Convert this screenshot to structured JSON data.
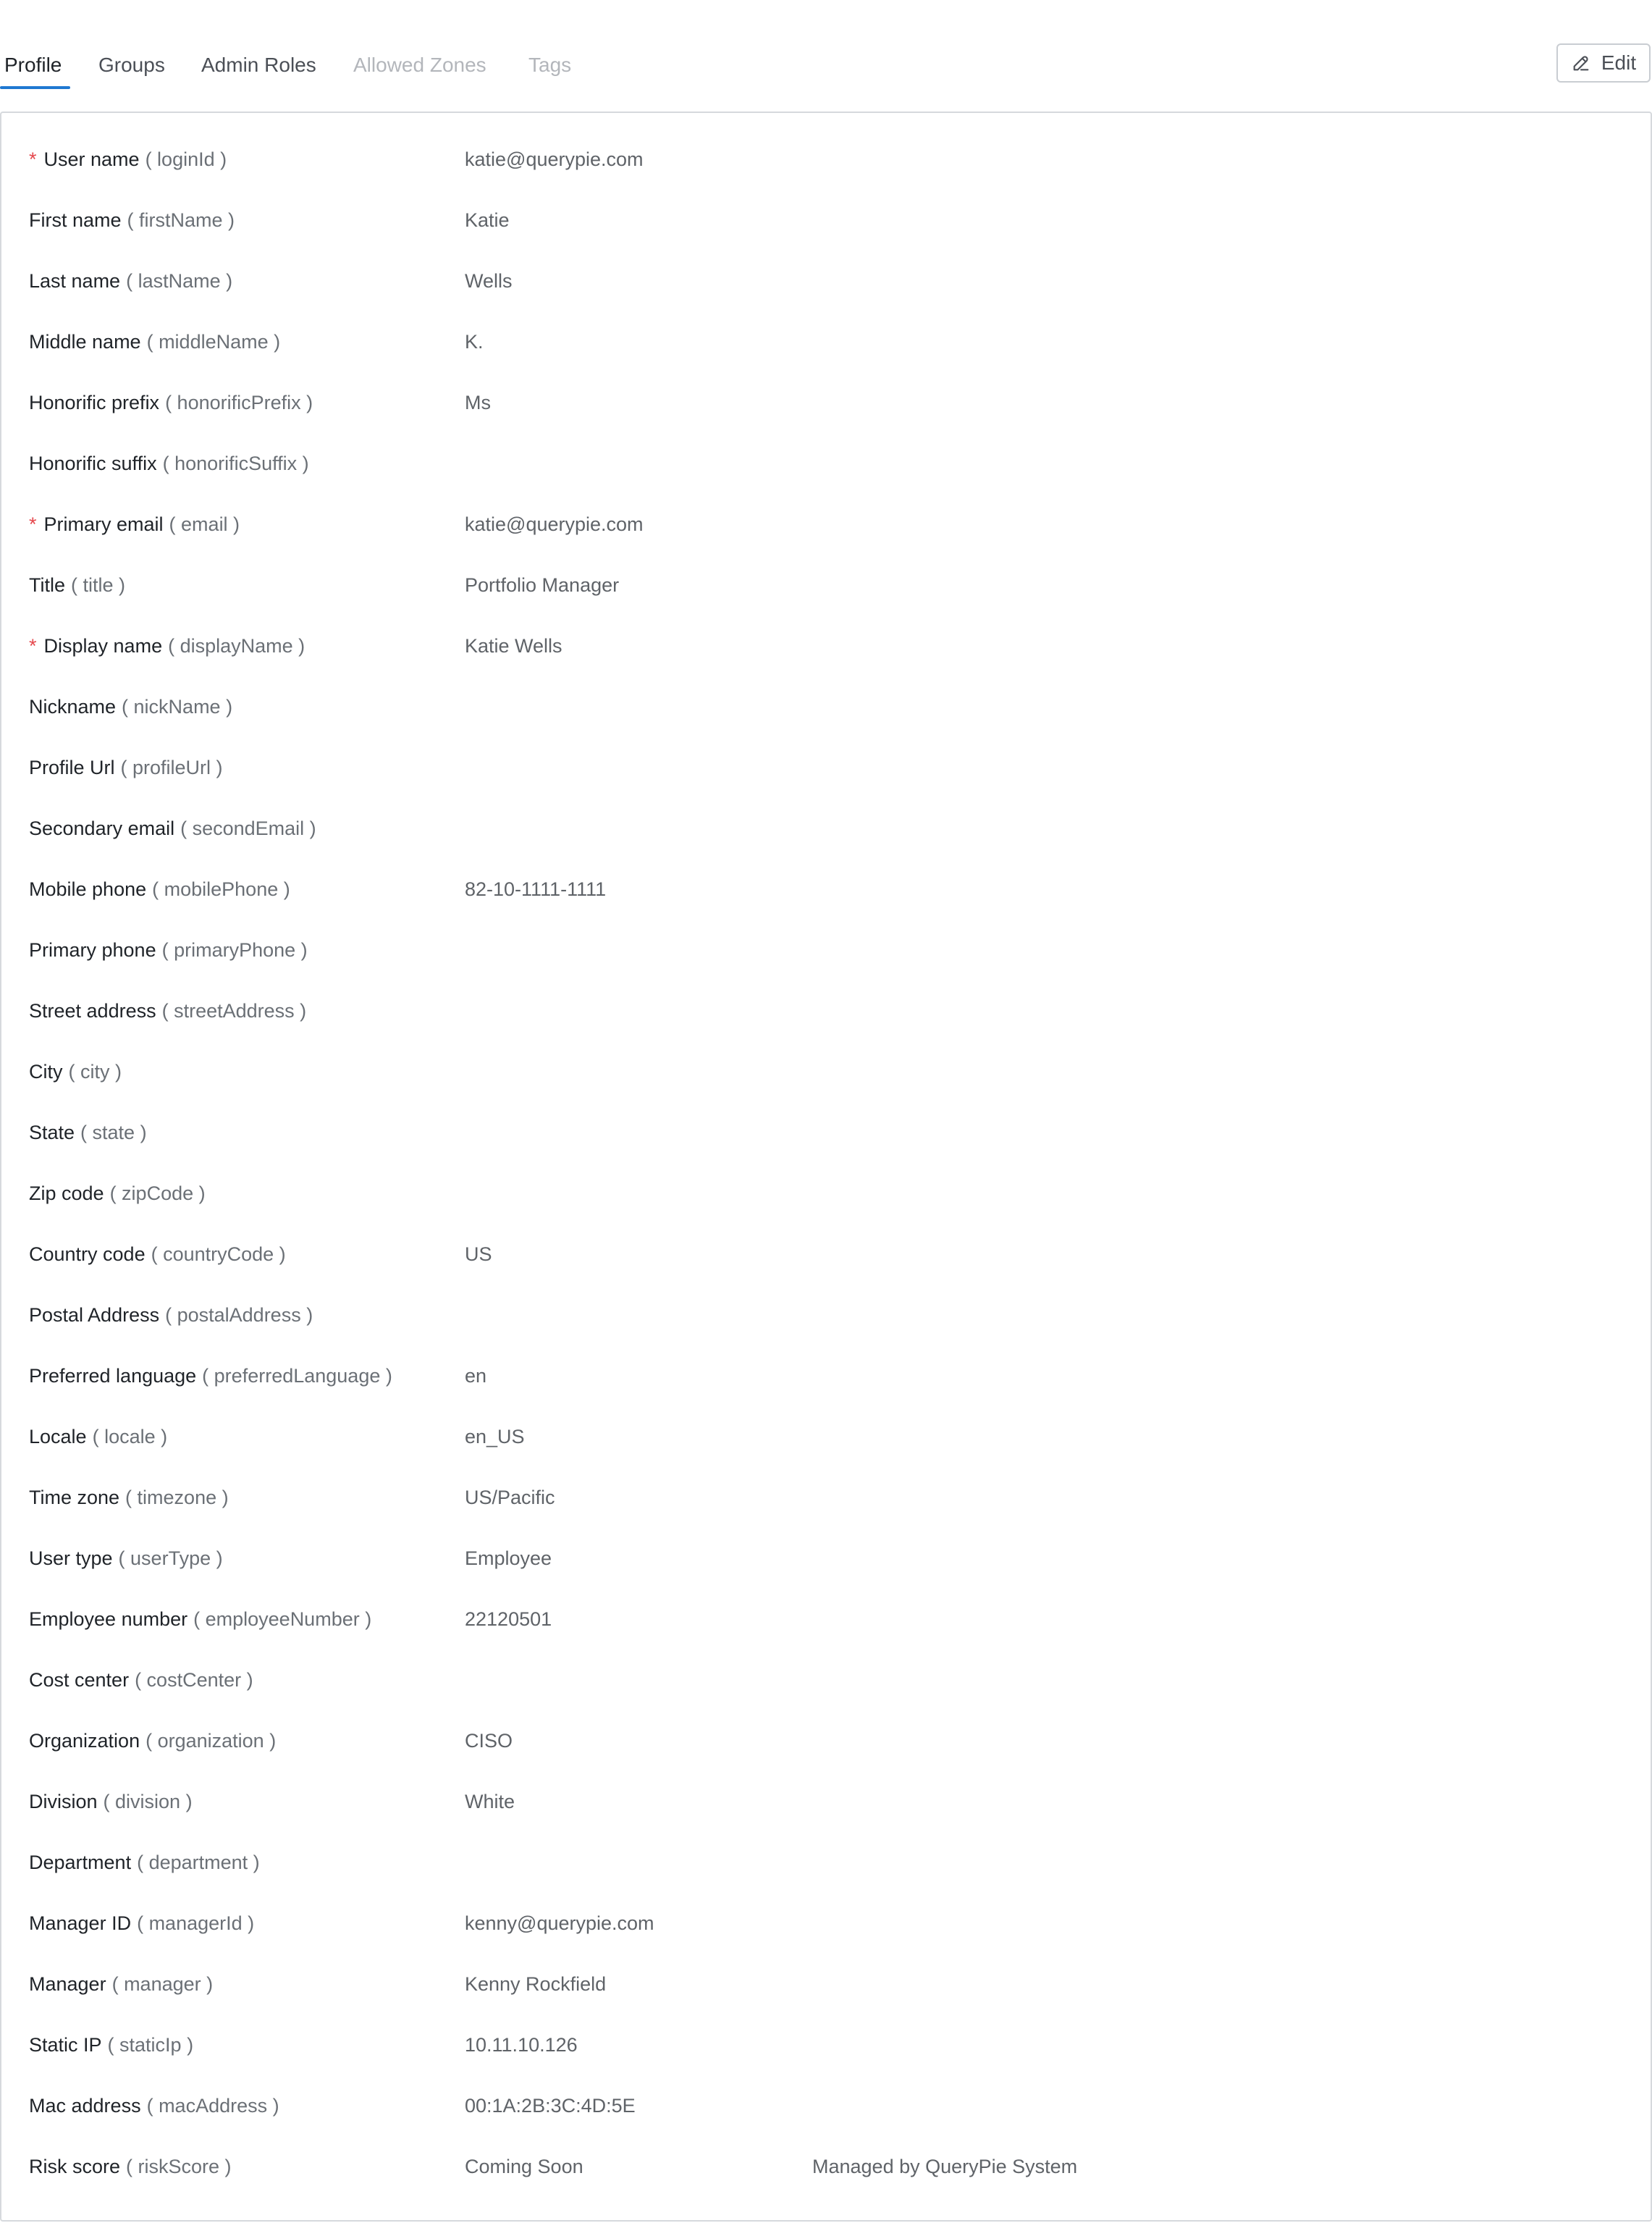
{
  "tabs": [
    {
      "label": "Profile",
      "state": "active"
    },
    {
      "label": "Groups",
      "state": "enabled"
    },
    {
      "label": "Admin Roles",
      "state": "enabled"
    },
    {
      "label": "Allowed Zones",
      "state": "disabled"
    },
    {
      "label": "Tags",
      "state": "disabled"
    }
  ],
  "edit_button": {
    "label": "Edit",
    "icon": "pencil-icon"
  },
  "colors": {
    "accent": "#1f78d1",
    "required": "#e5484d",
    "disabled_tab": "#b3b6bb"
  },
  "fields": [
    {
      "required": true,
      "name": "User name",
      "key": "( loginId )",
      "value": "katie@querypie.com"
    },
    {
      "required": false,
      "name": "First name",
      "key": "( firstName )",
      "value": "Katie"
    },
    {
      "required": false,
      "name": "Last name",
      "key": "( lastName )",
      "value": "Wells"
    },
    {
      "required": false,
      "name": "Middle name",
      "key": "( middleName )",
      "value": "K."
    },
    {
      "required": false,
      "name": "Honorific prefix",
      "key": "( honorificPrefix )",
      "value": "Ms"
    },
    {
      "required": false,
      "name": "Honorific suffix",
      "key": "( honorificSuffix )",
      "value": ""
    },
    {
      "required": true,
      "name": "Primary email",
      "key": "( email )",
      "value": "katie@querypie.com"
    },
    {
      "required": false,
      "name": "Title",
      "key": "( title )",
      "value": "Portfolio Manager"
    },
    {
      "required": true,
      "name": "Display name",
      "key": "( displayName )",
      "value": "Katie Wells"
    },
    {
      "required": false,
      "name": "Nickname",
      "key": "( nickName )",
      "value": ""
    },
    {
      "required": false,
      "name": "Profile Url",
      "key": "( profileUrl )",
      "value": ""
    },
    {
      "required": false,
      "name": "Secondary email",
      "key": "( secondEmail )",
      "value": ""
    },
    {
      "required": false,
      "name": "Mobile phone",
      "key": "( mobilePhone )",
      "value": "82-10-1111-1111"
    },
    {
      "required": false,
      "name": "Primary phone",
      "key": "( primaryPhone )",
      "value": ""
    },
    {
      "required": false,
      "name": "Street address",
      "key": "( streetAddress )",
      "value": ""
    },
    {
      "required": false,
      "name": "City",
      "key": "( city )",
      "value": ""
    },
    {
      "required": false,
      "name": "State",
      "key": "( state )",
      "value": ""
    },
    {
      "required": false,
      "name": "Zip code",
      "key": "( zipCode )",
      "value": ""
    },
    {
      "required": false,
      "name": "Country code",
      "key": "( countryCode )",
      "value": "US"
    },
    {
      "required": false,
      "name": "Postal Address",
      "key": "( postalAddress )",
      "value": ""
    },
    {
      "required": false,
      "name": "Preferred language",
      "key": "( preferredLanguage )",
      "value": "en"
    },
    {
      "required": false,
      "name": "Locale",
      "key": "( locale )",
      "value": "en_US"
    },
    {
      "required": false,
      "name": "Time zone",
      "key": "( timezone )",
      "value": "US/Pacific"
    },
    {
      "required": false,
      "name": "User type",
      "key": "( userType )",
      "value": "Employee"
    },
    {
      "required": false,
      "name": "Employee number",
      "key": "( employeeNumber )",
      "value": "22120501"
    },
    {
      "required": false,
      "name": "Cost center",
      "key": "( costCenter )",
      "value": ""
    },
    {
      "required": false,
      "name": "Organization",
      "key": "( organization )",
      "value": "CISO"
    },
    {
      "required": false,
      "name": "Division",
      "key": "( division )",
      "value": "White"
    },
    {
      "required": false,
      "name": "Department",
      "key": "( department )",
      "value": ""
    },
    {
      "required": false,
      "name": "Manager ID",
      "key": "( managerId )",
      "value": "kenny@querypie.com"
    },
    {
      "required": false,
      "name": "Manager",
      "key": "( manager )",
      "value": "Kenny Rockfield"
    },
    {
      "required": false,
      "name": "Static IP",
      "key": "( staticIp )",
      "value": "10.11.10.126"
    },
    {
      "required": false,
      "name": "Mac address",
      "key": "( macAddress )",
      "value": "00:1A:2B:3C:4D:5E"
    },
    {
      "required": false,
      "name": "Risk score",
      "key": "( riskScore )",
      "value": "Coming Soon",
      "note": "Managed by QueryPie System"
    }
  ]
}
